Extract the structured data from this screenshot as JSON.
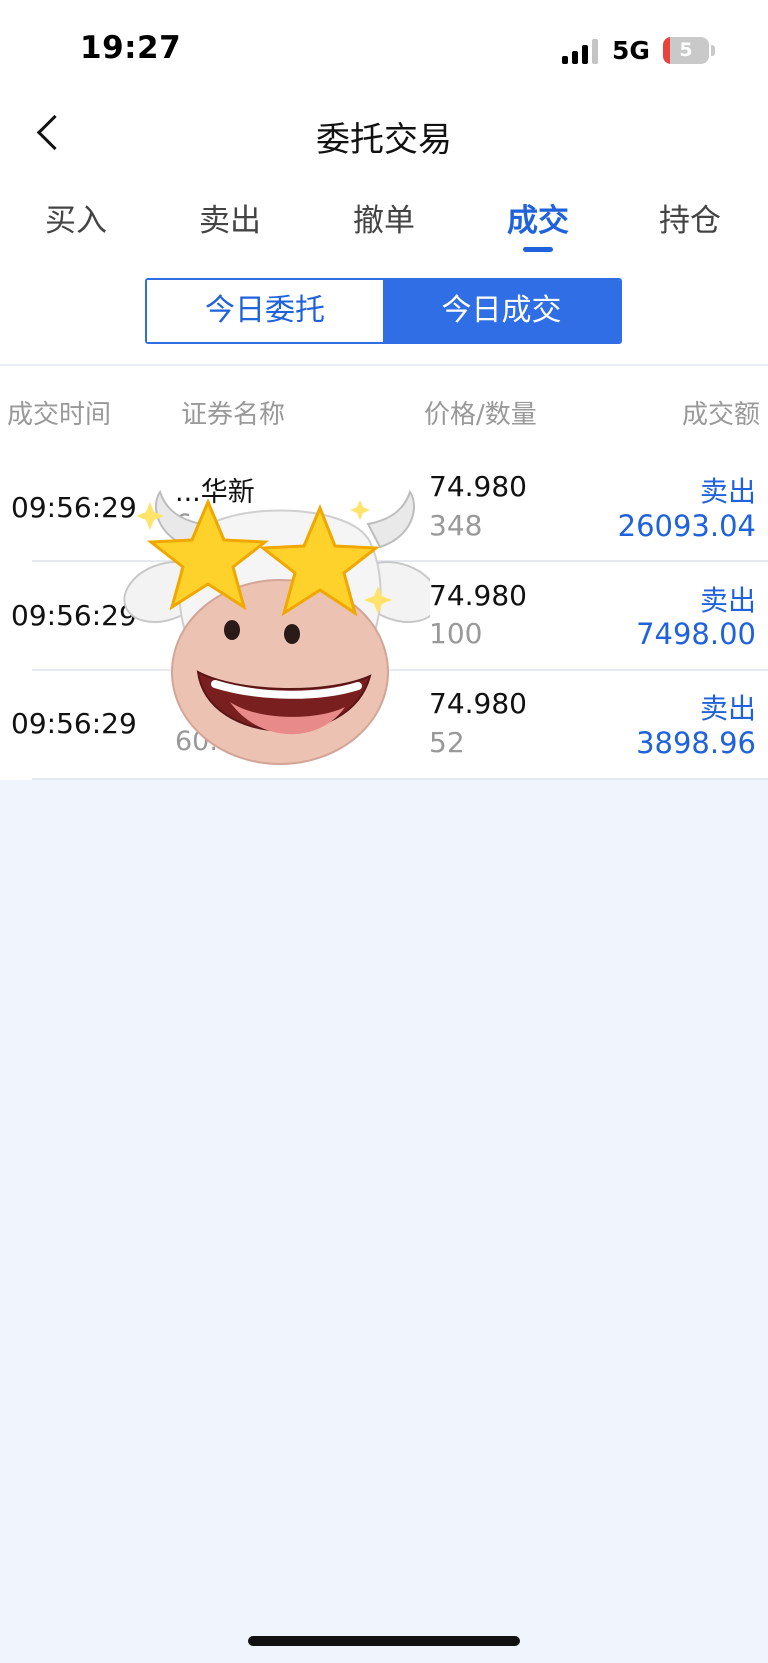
{
  "status_bar": {
    "time": "19:27",
    "network": "5G",
    "battery": "5"
  },
  "nav": {
    "title": "委托交易"
  },
  "tabs": [
    {
      "label": "买入"
    },
    {
      "label": "卖出"
    },
    {
      "label": "撤单"
    },
    {
      "label": "成交",
      "active": true
    },
    {
      "label": "持仓"
    }
  ],
  "segment": {
    "left": "今日委托",
    "right": "今日成交",
    "selected": "今日成交"
  },
  "table": {
    "headers": [
      "成交时间",
      "证券名称",
      "价格/数量",
      "成交额"
    ],
    "rows": [
      {
        "time": "09:56:29",
        "name": "...华新",
        "code": "6...",
        "price": "74.980",
        "qty": "348",
        "direction": "卖出",
        "amount": "26093.04"
      },
      {
        "time": "09:56:29",
        "name": "",
        "code": "",
        "price": "74.980",
        "qty": "100",
        "direction": "卖出",
        "amount": "7498.00"
      },
      {
        "time": "09:56:29",
        "name": "",
        "code": "60...",
        "price": "74.980",
        "qty": "52",
        "direction": "卖出",
        "amount": "3898.96"
      }
    ]
  },
  "colors": {
    "accent": "#2f6ee4",
    "accent_text": "#1f62db",
    "background": "#f0f4fd"
  },
  "sticker": {
    "icon": "cow-star-eyes-icon"
  }
}
